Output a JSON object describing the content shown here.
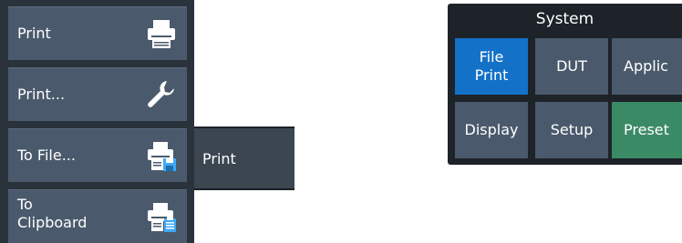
{
  "softkeys": {
    "print": {
      "label": "Print",
      "icon": "printer-icon"
    },
    "print_dialog": {
      "label": "Print...",
      "icon": "wrench-icon"
    },
    "to_file": {
      "label": "To File...",
      "icon": "printer-save-icon"
    },
    "to_clipboard": {
      "label": "To\nClipboard",
      "icon": "printer-clipboard-icon"
    }
  },
  "submenu": {
    "label": "Print"
  },
  "system": {
    "title": "System",
    "buttons": {
      "file_print": "File\nPrint",
      "dut": "DUT",
      "applic": "Applic",
      "display": "Display",
      "setup": "Setup",
      "preset": "Preset"
    }
  },
  "colors": {
    "button_bg": "#4a5a6c",
    "panel_bg": "#2a323c",
    "active_blue": "#1471c8",
    "preset_green": "#3b8a66",
    "icon_accent": "#3fa9f5"
  }
}
